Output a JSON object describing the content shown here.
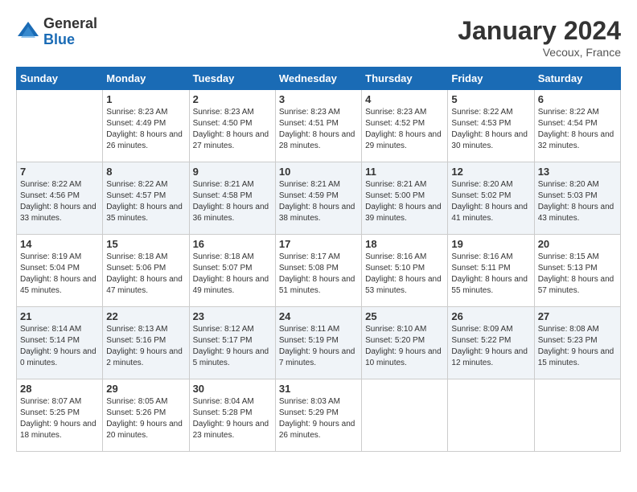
{
  "header": {
    "logo_general": "General",
    "logo_blue": "Blue",
    "month_title": "January 2024",
    "location": "Vecoux, France"
  },
  "days_of_week": [
    "Sunday",
    "Monday",
    "Tuesday",
    "Wednesday",
    "Thursday",
    "Friday",
    "Saturday"
  ],
  "weeks": [
    [
      {
        "day": "",
        "sunrise": "",
        "sunset": "",
        "daylight": "",
        "empty": true
      },
      {
        "day": "1",
        "sunrise": "Sunrise: 8:23 AM",
        "sunset": "Sunset: 4:49 PM",
        "daylight": "Daylight: 8 hours and 26 minutes."
      },
      {
        "day": "2",
        "sunrise": "Sunrise: 8:23 AM",
        "sunset": "Sunset: 4:50 PM",
        "daylight": "Daylight: 8 hours and 27 minutes."
      },
      {
        "day": "3",
        "sunrise": "Sunrise: 8:23 AM",
        "sunset": "Sunset: 4:51 PM",
        "daylight": "Daylight: 8 hours and 28 minutes."
      },
      {
        "day": "4",
        "sunrise": "Sunrise: 8:23 AM",
        "sunset": "Sunset: 4:52 PM",
        "daylight": "Daylight: 8 hours and 29 minutes."
      },
      {
        "day": "5",
        "sunrise": "Sunrise: 8:22 AM",
        "sunset": "Sunset: 4:53 PM",
        "daylight": "Daylight: 8 hours and 30 minutes."
      },
      {
        "day": "6",
        "sunrise": "Sunrise: 8:22 AM",
        "sunset": "Sunset: 4:54 PM",
        "daylight": "Daylight: 8 hours and 32 minutes."
      }
    ],
    [
      {
        "day": "7",
        "sunrise": "Sunrise: 8:22 AM",
        "sunset": "Sunset: 4:56 PM",
        "daylight": "Daylight: 8 hours and 33 minutes."
      },
      {
        "day": "8",
        "sunrise": "Sunrise: 8:22 AM",
        "sunset": "Sunset: 4:57 PM",
        "daylight": "Daylight: 8 hours and 35 minutes."
      },
      {
        "day": "9",
        "sunrise": "Sunrise: 8:21 AM",
        "sunset": "Sunset: 4:58 PM",
        "daylight": "Daylight: 8 hours and 36 minutes."
      },
      {
        "day": "10",
        "sunrise": "Sunrise: 8:21 AM",
        "sunset": "Sunset: 4:59 PM",
        "daylight": "Daylight: 8 hours and 38 minutes."
      },
      {
        "day": "11",
        "sunrise": "Sunrise: 8:21 AM",
        "sunset": "Sunset: 5:00 PM",
        "daylight": "Daylight: 8 hours and 39 minutes."
      },
      {
        "day": "12",
        "sunrise": "Sunrise: 8:20 AM",
        "sunset": "Sunset: 5:02 PM",
        "daylight": "Daylight: 8 hours and 41 minutes."
      },
      {
        "day": "13",
        "sunrise": "Sunrise: 8:20 AM",
        "sunset": "Sunset: 5:03 PM",
        "daylight": "Daylight: 8 hours and 43 minutes."
      }
    ],
    [
      {
        "day": "14",
        "sunrise": "Sunrise: 8:19 AM",
        "sunset": "Sunset: 5:04 PM",
        "daylight": "Daylight: 8 hours and 45 minutes."
      },
      {
        "day": "15",
        "sunrise": "Sunrise: 8:18 AM",
        "sunset": "Sunset: 5:06 PM",
        "daylight": "Daylight: 8 hours and 47 minutes."
      },
      {
        "day": "16",
        "sunrise": "Sunrise: 8:18 AM",
        "sunset": "Sunset: 5:07 PM",
        "daylight": "Daylight: 8 hours and 49 minutes."
      },
      {
        "day": "17",
        "sunrise": "Sunrise: 8:17 AM",
        "sunset": "Sunset: 5:08 PM",
        "daylight": "Daylight: 8 hours and 51 minutes."
      },
      {
        "day": "18",
        "sunrise": "Sunrise: 8:16 AM",
        "sunset": "Sunset: 5:10 PM",
        "daylight": "Daylight: 8 hours and 53 minutes."
      },
      {
        "day": "19",
        "sunrise": "Sunrise: 8:16 AM",
        "sunset": "Sunset: 5:11 PM",
        "daylight": "Daylight: 8 hours and 55 minutes."
      },
      {
        "day": "20",
        "sunrise": "Sunrise: 8:15 AM",
        "sunset": "Sunset: 5:13 PM",
        "daylight": "Daylight: 8 hours and 57 minutes."
      }
    ],
    [
      {
        "day": "21",
        "sunrise": "Sunrise: 8:14 AM",
        "sunset": "Sunset: 5:14 PM",
        "daylight": "Daylight: 9 hours and 0 minutes."
      },
      {
        "day": "22",
        "sunrise": "Sunrise: 8:13 AM",
        "sunset": "Sunset: 5:16 PM",
        "daylight": "Daylight: 9 hours and 2 minutes."
      },
      {
        "day": "23",
        "sunrise": "Sunrise: 8:12 AM",
        "sunset": "Sunset: 5:17 PM",
        "daylight": "Daylight: 9 hours and 5 minutes."
      },
      {
        "day": "24",
        "sunrise": "Sunrise: 8:11 AM",
        "sunset": "Sunset: 5:19 PM",
        "daylight": "Daylight: 9 hours and 7 minutes."
      },
      {
        "day": "25",
        "sunrise": "Sunrise: 8:10 AM",
        "sunset": "Sunset: 5:20 PM",
        "daylight": "Daylight: 9 hours and 10 minutes."
      },
      {
        "day": "26",
        "sunrise": "Sunrise: 8:09 AM",
        "sunset": "Sunset: 5:22 PM",
        "daylight": "Daylight: 9 hours and 12 minutes."
      },
      {
        "day": "27",
        "sunrise": "Sunrise: 8:08 AM",
        "sunset": "Sunset: 5:23 PM",
        "daylight": "Daylight: 9 hours and 15 minutes."
      }
    ],
    [
      {
        "day": "28",
        "sunrise": "Sunrise: 8:07 AM",
        "sunset": "Sunset: 5:25 PM",
        "daylight": "Daylight: 9 hours and 18 minutes."
      },
      {
        "day": "29",
        "sunrise": "Sunrise: 8:05 AM",
        "sunset": "Sunset: 5:26 PM",
        "daylight": "Daylight: 9 hours and 20 minutes."
      },
      {
        "day": "30",
        "sunrise": "Sunrise: 8:04 AM",
        "sunset": "Sunset: 5:28 PM",
        "daylight": "Daylight: 9 hours and 23 minutes."
      },
      {
        "day": "31",
        "sunrise": "Sunrise: 8:03 AM",
        "sunset": "Sunset: 5:29 PM",
        "daylight": "Daylight: 9 hours and 26 minutes."
      },
      {
        "day": "",
        "sunrise": "",
        "sunset": "",
        "daylight": "",
        "empty": true
      },
      {
        "day": "",
        "sunrise": "",
        "sunset": "",
        "daylight": "",
        "empty": true
      },
      {
        "day": "",
        "sunrise": "",
        "sunset": "",
        "daylight": "",
        "empty": true
      }
    ]
  ]
}
